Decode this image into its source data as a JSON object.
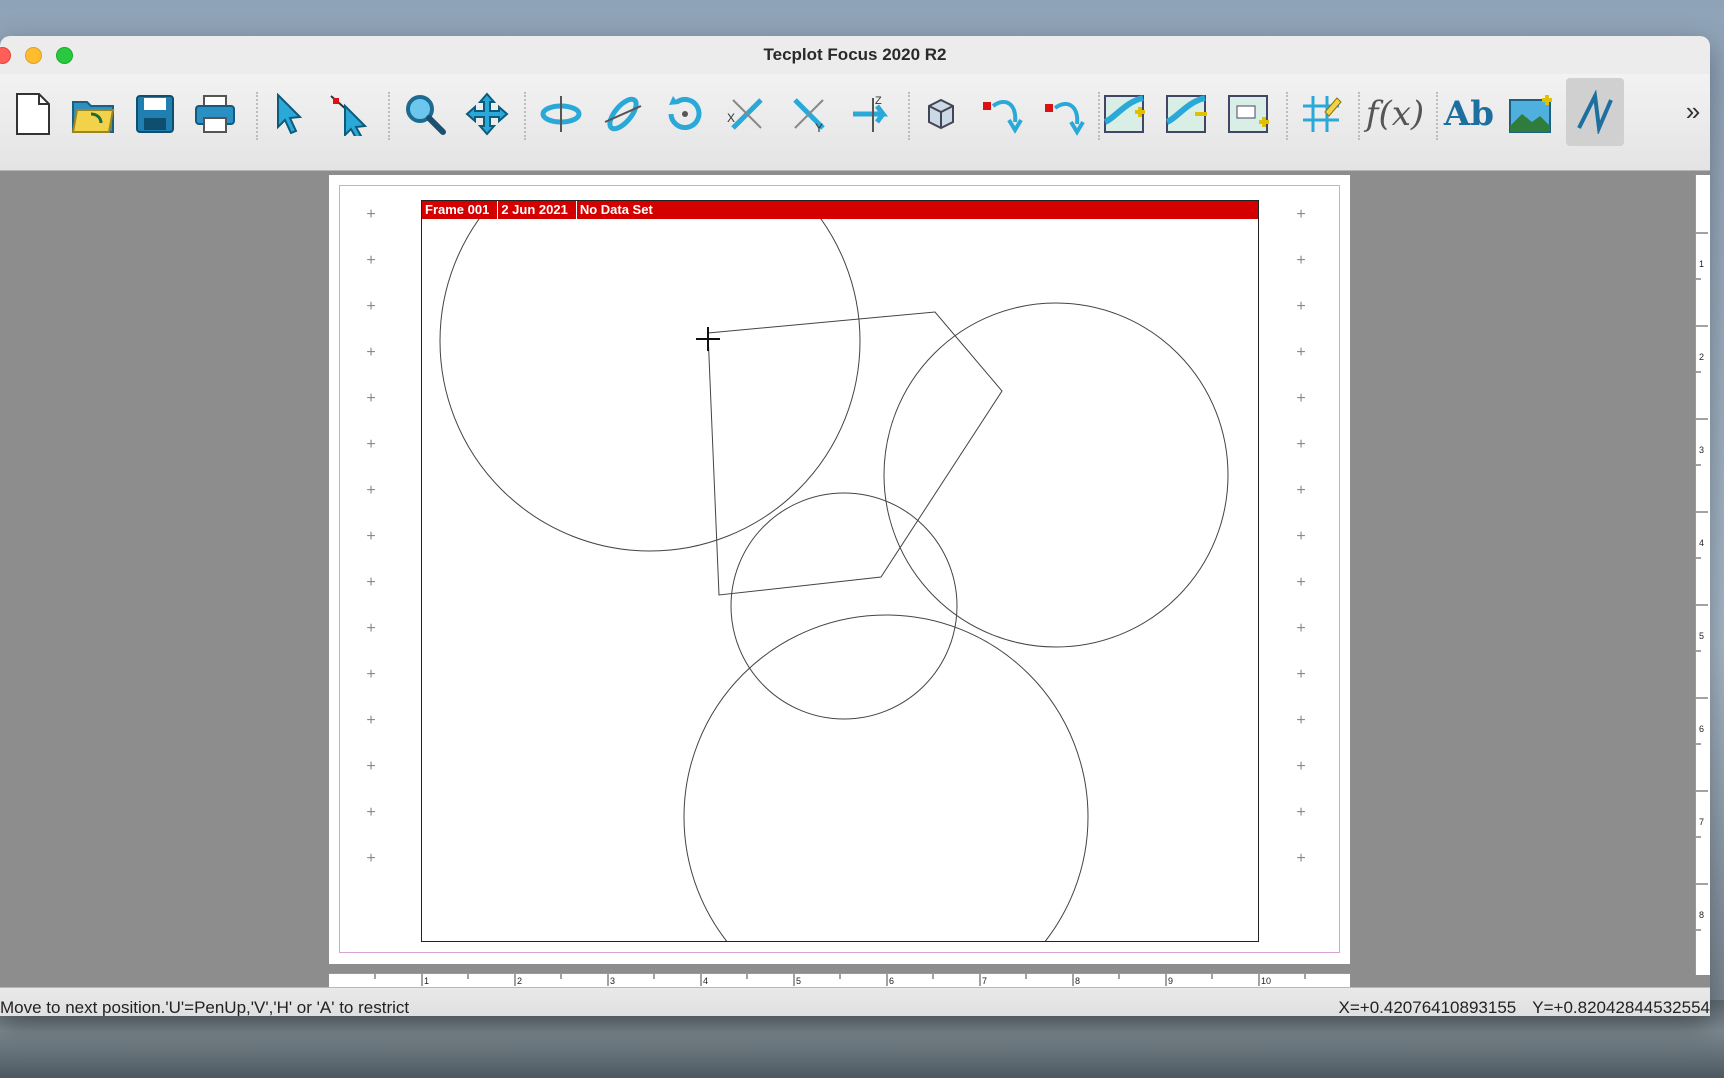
{
  "window": {
    "title": "Tecplot Focus 2020 R2"
  },
  "toolbar": {
    "buttons": [
      {
        "name": "new-layout-icon"
      },
      {
        "name": "open-layout-icon"
      },
      {
        "name": "save-icon"
      },
      {
        "name": "print-icon"
      },
      {
        "name": "selector-arrow-icon"
      },
      {
        "name": "adjustor-arrow-icon"
      },
      {
        "name": "zoom-icon"
      },
      {
        "name": "translate-icon"
      },
      {
        "name": "rotate-x-icon"
      },
      {
        "name": "rotate-y-icon"
      },
      {
        "name": "rotate-spherical-icon"
      },
      {
        "name": "rotate-xy-icon"
      },
      {
        "name": "rotate-yx-icon"
      },
      {
        "name": "rotate-z-icon"
      },
      {
        "name": "3d-box-icon"
      },
      {
        "name": "probe-curve-icon"
      },
      {
        "name": "probe-curve-2-icon"
      },
      {
        "name": "add-contour-icon"
      },
      {
        "name": "remove-contour-icon"
      },
      {
        "name": "contour-label-icon"
      },
      {
        "name": "slice-grid-icon"
      },
      {
        "name": "fx-equation-icon"
      },
      {
        "name": "text-ab-icon"
      },
      {
        "name": "add-image-icon"
      },
      {
        "name": "polyline-icon"
      }
    ],
    "fx_label": "f(x)",
    "ab_label": "Ab",
    "more_label": "»"
  },
  "frame": {
    "header": [
      "Frame 001",
      "2 Jun 2021",
      "No Data Set"
    ]
  },
  "rulers": {
    "horizontal_labels": [
      "1",
      "2",
      "3",
      "4",
      "5",
      "6",
      "7",
      "8",
      "9",
      "10"
    ],
    "vertical_labels": [
      "1",
      "2",
      "3",
      "4",
      "5",
      "6",
      "7",
      "8"
    ]
  },
  "status": {
    "message": "Move to next position.'U'=PenUp,'V','H' or 'A' to restrict",
    "x_readout": "X=+0.42076410893155",
    "y_readout": "Y=+0.82042844532554"
  }
}
